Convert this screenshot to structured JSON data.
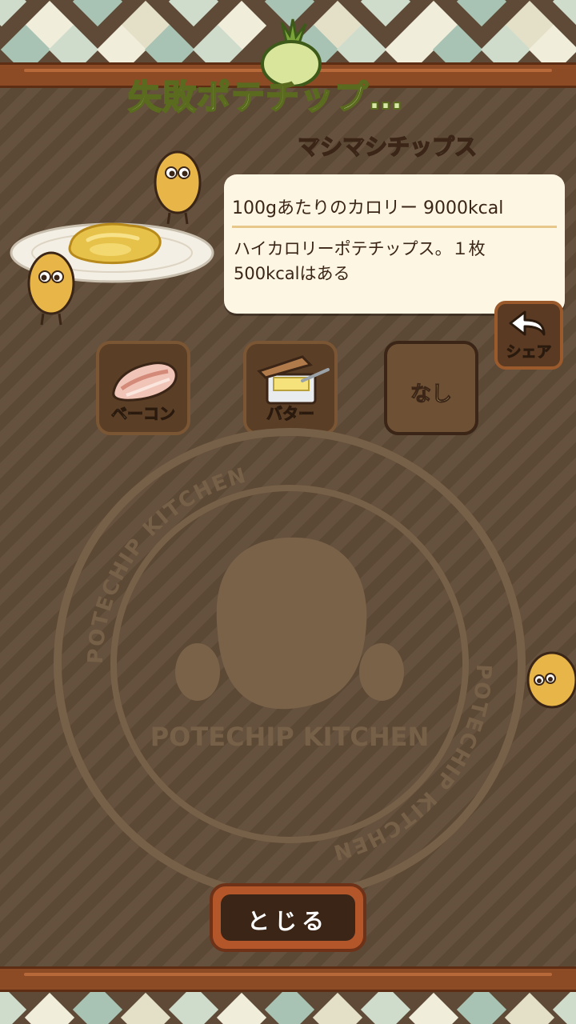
{
  "header": {
    "title": "失敗ポテチップ…",
    "subtitle": "マシマシチップス"
  },
  "info": {
    "calorie": "100gあたりのカロリー 9000kcal",
    "description": "ハイカロリーポテチップス。１枚\n500kcalはある"
  },
  "share": {
    "label": "シェア"
  },
  "toppings": [
    {
      "label": "ベーコン",
      "icon": "bacon-icon"
    },
    {
      "label": "バター",
      "icon": "butter-icon"
    },
    {
      "label": "なし",
      "icon": ""
    }
  ],
  "emblem": {
    "ring_text": "POTECHIP KITCHEN",
    "center_text": "POTECHIP KITCHEN"
  },
  "close": {
    "label": "とじる"
  },
  "colors": {
    "board": "#5f4b37",
    "title_fill": "#d8e8a6",
    "rail": "#8c4a25",
    "card": "#fdf6e3",
    "close_button": "#b3562a"
  }
}
